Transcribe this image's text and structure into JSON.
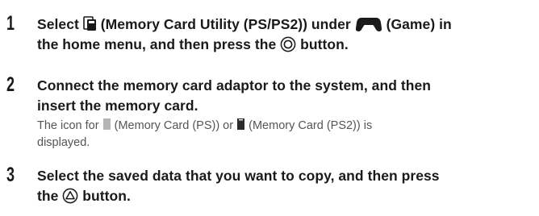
{
  "steps": [
    {
      "number": "1",
      "title_parts": {
        "select": "Select",
        "memory_card_utility": "(Memory Card Utility (PS/PS2)) under",
        "game": "(Game) in",
        "line2": "the home menu, and then press the",
        "button_end": "button."
      },
      "icons": [
        "memory-card-utility-icon",
        "game-controller-icon",
        "circle-button-icon"
      ]
    },
    {
      "number": "2",
      "title": "Connect the memory card adaptor to the system, and then",
      "title_line2": "insert the memory card.",
      "body_parts": {
        "start": "The icon for",
        "ps": "(Memory Card (PS)) or",
        "ps2": "(Memory Card (PS2)) is",
        "line2": "displayed."
      },
      "icons": [
        "memory-card-ps-icon",
        "memory-card-ps2-icon"
      ]
    },
    {
      "number": "3",
      "title": "Select the saved data that you want to copy, and then press",
      "title_line2_start": "the",
      "title_line2_end": "button.",
      "icons": [
        "triangle-button-icon"
      ]
    }
  ],
  "colors": {
    "heading_text": "#1a1a1a",
    "body_text": "#555555",
    "ps_card_gray": "#b5b5b5",
    "ps2_card_dark": "#2b2b2b"
  }
}
